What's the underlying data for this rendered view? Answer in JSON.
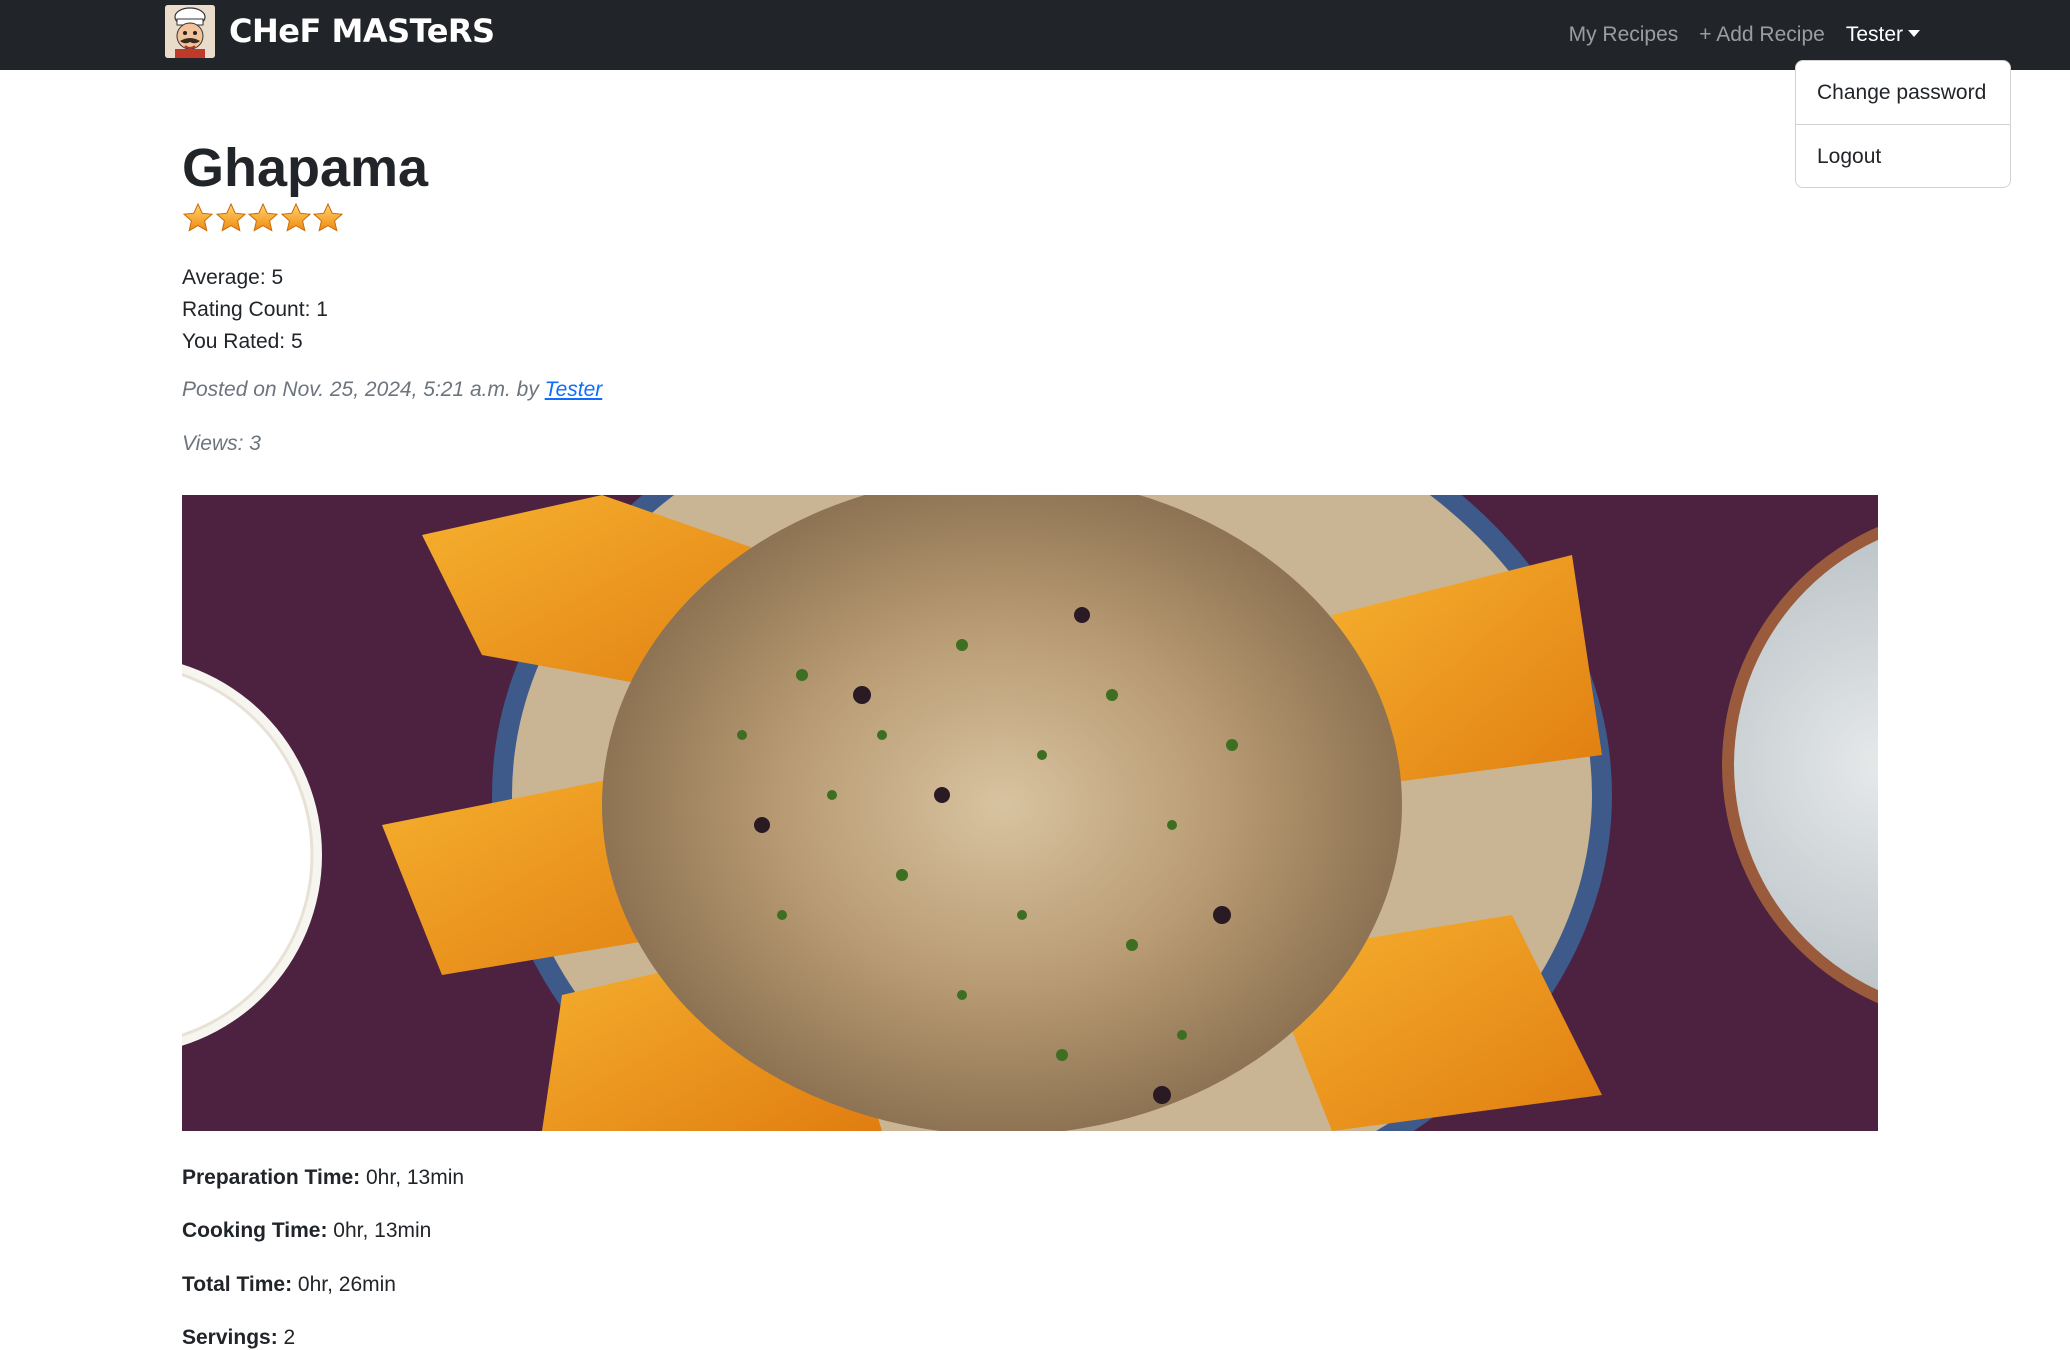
{
  "nav": {
    "brand": "CHeF MASTeRS",
    "links": {
      "my_recipes": "My Recipes",
      "add_recipe": "+ Add Recipe",
      "user": "Tester"
    },
    "dropdown": {
      "change_password": "Change password",
      "logout": "Logout"
    },
    "icons": {
      "logo": "chef-logo-icon",
      "caret": "caret-down-icon"
    }
  },
  "recipe": {
    "title": "Ghapama",
    "rating": {
      "stars_filled": 5,
      "stars_total": 5,
      "average": "Average: 5",
      "count": "Rating Count: 1",
      "you_rated": "You Rated: 5"
    },
    "posted_prefix": "Posted on Nov. 25, 2024, 5:21 a.m. by ",
    "author": "Tester",
    "views": "Views: 3",
    "prep_label": "Preparation Time:",
    "prep_value": " 0hr, 13min",
    "cook_label": "Cooking Time:",
    "cook_value": " 0hr, 13min",
    "total_label": "Total Time:",
    "total_value": " 0hr, 26min",
    "servings_label": "Servings:",
    "servings_value": " 2"
  },
  "colors": {
    "navbar_bg": "#212529",
    "link_blue": "#0d6efd",
    "star": "#f4a623",
    "muted_text": "#6c757d"
  }
}
